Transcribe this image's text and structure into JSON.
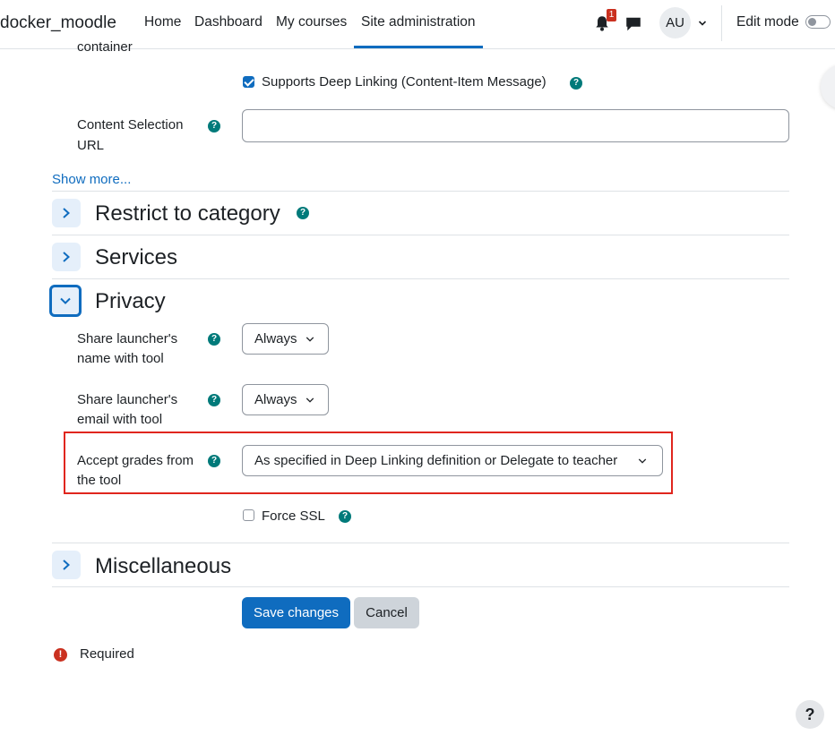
{
  "navbar": {
    "brand": "docker_moodle",
    "links": [
      "Home",
      "Dashboard",
      "My courses",
      "Site administration"
    ],
    "active_link": "Site administration",
    "notification_count": "1",
    "avatar_initials": "AU",
    "edit_mode_label": "Edit mode"
  },
  "form": {
    "cut_label": "container",
    "deep_linking_label": "Supports Deep Linking (Content-Item Message)",
    "content_selection_label_1": "Content Selection",
    "content_selection_label_2": "URL",
    "content_selection_value": "",
    "show_more": "Show more...",
    "sections": {
      "restrict": "Restrict to category",
      "services": "Services",
      "privacy": "Privacy",
      "misc": "Miscellaneous"
    },
    "privacy": {
      "share_name_label_1": "Share launcher's",
      "share_name_label_2": "name with tool",
      "share_name_value": "Always",
      "share_email_label_1": "Share launcher's",
      "share_email_label_2": "email with tool",
      "share_email_value": "Always",
      "accept_grades_label_1": "Accept grades from",
      "accept_grades_label_2": "the tool",
      "accept_grades_value": "As specified in Deep Linking definition or Delegate to teacher",
      "force_ssl_label": "Force SSL"
    },
    "buttons": {
      "save": "Save changes",
      "cancel": "Cancel"
    },
    "required_label": "Required",
    "help_glyph": "?",
    "required_glyph": "!"
  },
  "colors": {
    "primary": "#0f6cbf",
    "help": "#007a7a",
    "danger": "#ca3120",
    "highlight": "#e0261e"
  }
}
